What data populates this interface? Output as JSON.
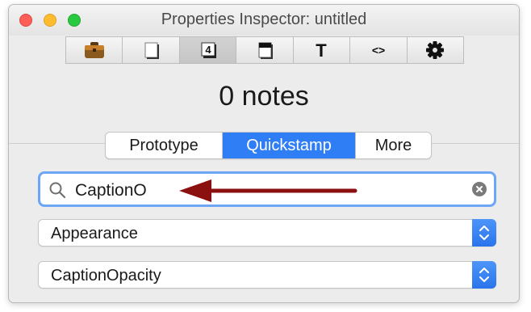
{
  "window": {
    "title": "Properties Inspector: untitled"
  },
  "toolbar": {
    "buttons": [
      {
        "icon": "briefcase-icon"
      },
      {
        "icon": "note-page-icon"
      },
      {
        "icon": "badge-four-icon",
        "active": true,
        "label": "4"
      },
      {
        "icon": "appearance-icon"
      },
      {
        "icon": "text-icon",
        "label": "T"
      },
      {
        "icon": "code-brackets-icon",
        "label": "<>"
      },
      {
        "icon": "gear-icon"
      }
    ]
  },
  "summary": {
    "notes_count": "0 notes"
  },
  "tabs": [
    {
      "label": "Prototype",
      "selected": false
    },
    {
      "label": "Quickstamp",
      "selected": true
    },
    {
      "label": "More",
      "selected": false
    }
  ],
  "search": {
    "value": "CaptionO"
  },
  "category_select": {
    "value": "Appearance"
  },
  "attribute_select": {
    "value": "CaptionOpacity"
  },
  "colors": {
    "accent": "#2f7ef5",
    "annotation_arrow": "#8b1010"
  }
}
